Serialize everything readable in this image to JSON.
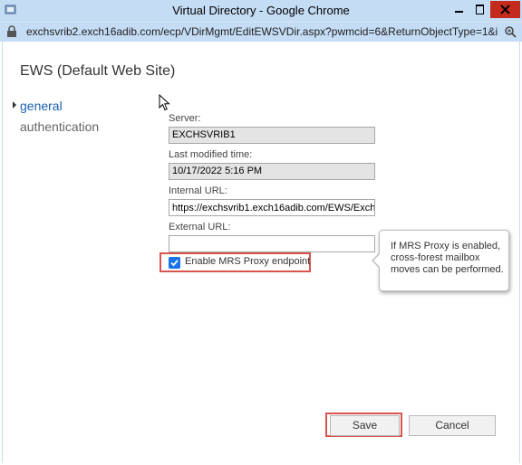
{
  "window": {
    "title": "Virtual Directory - Google Chrome",
    "url": "exchsvrib2.exch16adib.com/ecp/VDirMgmt/EditEWSVDir.aspx?pwmcid=6&ReturnObjectType=1&id=a5..."
  },
  "page": {
    "title": "EWS (Default Web Site)"
  },
  "nav": {
    "items": [
      {
        "label": "general"
      },
      {
        "label": "authentication"
      }
    ]
  },
  "form": {
    "server_label": "Server:",
    "server_value": "EXCHSVRIB1",
    "modified_label": "Last modified time:",
    "modified_value": "10/17/2022 5:16 PM",
    "internal_url_label": "Internal URL:",
    "internal_url_value": "https://exchsvrib1.exch16adib.com/EWS/Exchar",
    "external_url_label": "External URL:",
    "external_url_value": "",
    "mrs_proxy_label": "Enable MRS Proxy endpoint",
    "mrs_proxy_checked": true
  },
  "tooltip": {
    "text": "If MRS Proxy is enabled, cross-forest mailbox moves can be performed."
  },
  "buttons": {
    "save": "Save",
    "cancel": "Cancel"
  },
  "colors": {
    "titlebar": "#c4dcf4",
    "close": "#c42b1c",
    "link": "#1a5fb4",
    "highlight": "#d9534f",
    "checkbox": "#1a73e8"
  }
}
